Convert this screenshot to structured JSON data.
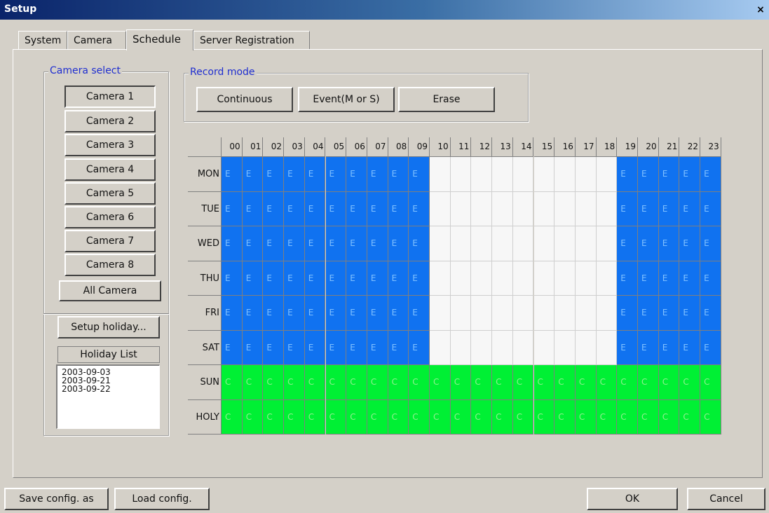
{
  "window": {
    "title": "Setup",
    "close_glyph": "×"
  },
  "tabs": [
    {
      "label": "System"
    },
    {
      "label": "Camera"
    },
    {
      "label": "Schedule"
    },
    {
      "label": "Server Registration"
    }
  ],
  "active_tab": "Schedule",
  "camera_select": {
    "legend": "Camera select",
    "cameras": [
      "Camera 1",
      "Camera 2",
      "Camera 3",
      "Camera 4",
      "Camera 5",
      "Camera 6",
      "Camera 7",
      "Camera 8"
    ],
    "selected": "Camera 1",
    "all_label": "All Camera"
  },
  "holiday": {
    "setup_label": "Setup holiday...",
    "list_label": "Holiday List",
    "dates": [
      "2003-09-03",
      "2003-09-21",
      "2003-09-22"
    ]
  },
  "record_mode": {
    "legend": "Record mode",
    "buttons": [
      "Continuous",
      "Event(M or S)",
      "Erase"
    ]
  },
  "schedule": {
    "hours": [
      "00",
      "01",
      "02",
      "03",
      "04",
      "05",
      "06",
      "07",
      "08",
      "09",
      "10",
      "11",
      "12",
      "13",
      "14",
      "15",
      "16",
      "17",
      "18",
      "19",
      "20",
      "21",
      "22",
      "23"
    ],
    "days": [
      "MON",
      "TUE",
      "WED",
      "THU",
      "FRI",
      "SAT",
      "SUN",
      "HOLY"
    ],
    "rows": [
      "EEEEEEEEEE---------EEEEE",
      "EEEEEEEEEE---------EEEEE",
      "EEEEEEEEEE---------EEEEE",
      "EEEEEEEEEE---------EEEEE",
      "EEEEEEEEEE---------EEEEE",
      "EEEEEEEEEE---------EEEEE",
      "CCCCCCCCCCCCCCCCCCCCCCCC",
      "CCCCCCCCCCCCCCCCCCCCCCCC"
    ],
    "colors": {
      "E": "#1072f0",
      "C": "#00f034",
      "empty": "#f7f7f7"
    }
  },
  "footer": {
    "save_label": "Save config. as",
    "load_label": "Load config.",
    "ok_label": "OK",
    "cancel_label": "Cancel"
  }
}
